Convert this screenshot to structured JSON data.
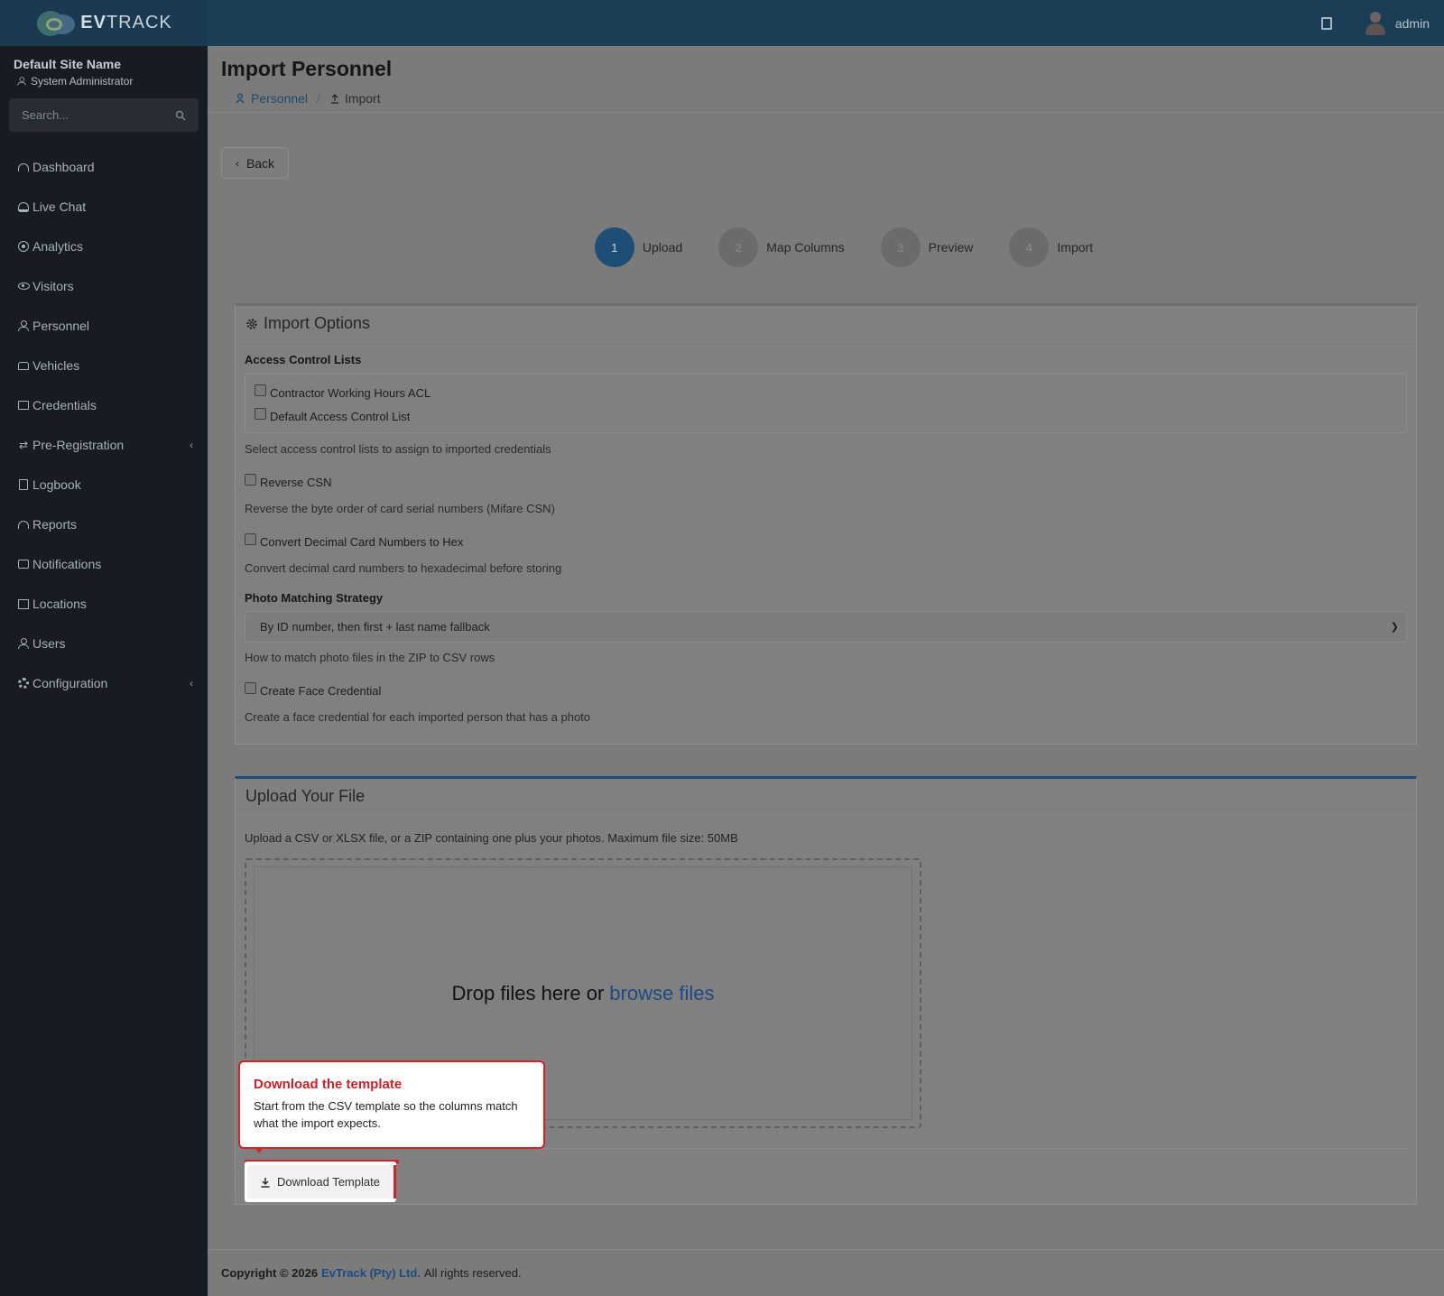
{
  "topbar": {
    "brand": {
      "logo_prefix": "EV",
      "logo_suffix": "TRACK"
    },
    "username": "admin"
  },
  "sidebar": {
    "site_name": "Default Site Name",
    "role": "System Administrator",
    "search_placeholder": "Search...",
    "items": [
      {
        "label": "Dashboard",
        "icon": "dashboard-icon"
      },
      {
        "label": "Live Chat",
        "icon": "headset-icon"
      },
      {
        "label": "Analytics",
        "icon": "analytics-icon"
      },
      {
        "label": "Visitors",
        "icon": "eye-icon"
      },
      {
        "label": "Personnel",
        "icon": "personnel-icon"
      },
      {
        "label": "Vehicles",
        "icon": "car-icon"
      },
      {
        "label": "Credentials",
        "icon": "credential-icon"
      },
      {
        "label": "Pre-Registration",
        "icon": "arrows-icon",
        "has_submenu": true
      },
      {
        "label": "Logbook",
        "icon": "book-icon"
      },
      {
        "label": "Reports",
        "icon": "reports-icon"
      },
      {
        "label": "Notifications",
        "icon": "chat-icon"
      },
      {
        "label": "Locations",
        "icon": "map-icon"
      },
      {
        "label": "Users",
        "icon": "user-gear-icon"
      },
      {
        "label": "Configuration",
        "icon": "gear-icon",
        "has_submenu": true
      }
    ]
  },
  "page": {
    "title": "Import Personnel",
    "breadcrumb": {
      "parent": "Personnel",
      "separator": "/",
      "current": "Import"
    },
    "back_label": "Back"
  },
  "stepper": [
    {
      "num": "1",
      "label": "Upload",
      "active": true
    },
    {
      "num": "2",
      "label": "Map Columns",
      "active": false
    },
    {
      "num": "3",
      "label": "Preview",
      "active": false
    },
    {
      "num": "4",
      "label": "Import",
      "active": false
    }
  ],
  "import_options": {
    "title": "Import Options",
    "acl_label": "Access Control Lists",
    "acl_items": [
      "Contractor Working Hours ACL",
      "Default Access Control List"
    ],
    "acl_help": "Select access control lists to assign to imported credentials",
    "reverse_csn_label": "Reverse CSN",
    "reverse_csn_help": "Reverse the byte order of card serial numbers (Mifare CSN)",
    "convert_label": "Convert Decimal Card Numbers to Hex",
    "convert_help": "Convert decimal card numbers to hexadecimal before storing",
    "photo_label": "Photo Matching Strategy",
    "photo_selected": "By ID number, then first + last name fallback",
    "photo_help": "How to match photo files in the ZIP to CSV rows",
    "face_label": "Create Face Credential",
    "face_help": "Create a face credential for each imported person that has a photo"
  },
  "upload": {
    "title": "Upload Your File",
    "description": "Upload a CSV or XLSX file, or a ZIP containing one plus your photos. Maximum file size: 50MB",
    "drop_text": "Drop files here or",
    "browse_text": "browse files",
    "download_label": "Download Template"
  },
  "tooltip": {
    "title": "Download the template",
    "body": "Start from the CSV template so the columns match what the import expects."
  },
  "footer": {
    "prefix": "Copyright © 2026",
    "company": "EvTrack (Pty) Ltd.",
    "suffix": "All rights reserved."
  },
  "colors": {
    "primary": "#1e4d75",
    "highlight": "#d2232a",
    "sidebar_bg": "#161c21"
  }
}
